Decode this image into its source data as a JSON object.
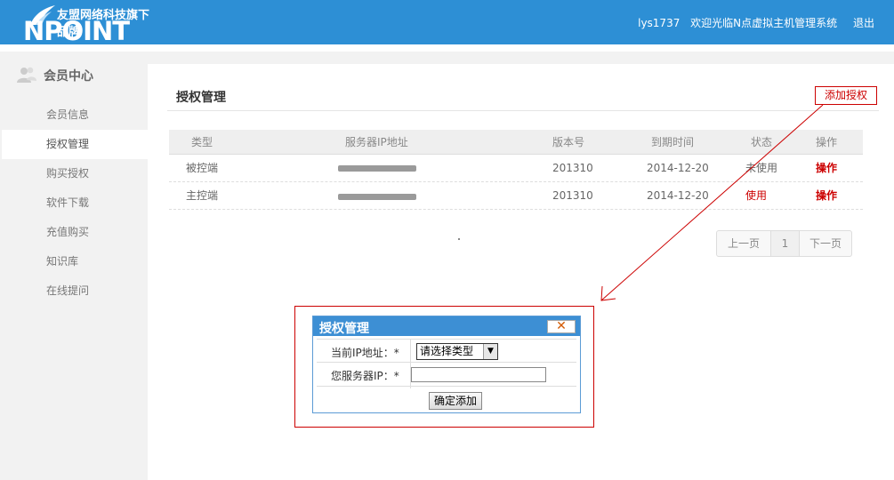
{
  "header": {
    "slogan": "友盟网络科技旗下品牌",
    "brand": "NPOINT",
    "username": "lys1737",
    "welcome": "欢迎光临N点虚拟主机管理系统",
    "logout": "退出"
  },
  "sidebar": {
    "title": "会员中心",
    "items": [
      {
        "label": "会员信息"
      },
      {
        "label": "授权管理"
      },
      {
        "label": "购买授权"
      },
      {
        "label": "软件下载"
      },
      {
        "label": "充值购买"
      },
      {
        "label": "知识库"
      },
      {
        "label": "在线提问"
      }
    ]
  },
  "main": {
    "title": "授权管理",
    "add_button": "添加授权",
    "table": {
      "headers": [
        "类型",
        "服务器IP地址",
        "版本号",
        "到期时间",
        "状态",
        "操作"
      ],
      "rows": [
        {
          "type": "被控端",
          "version": "201310",
          "expiry": "2014-12-20",
          "status": "未使用",
          "action": "操作"
        },
        {
          "type": "主控端",
          "version": "201310",
          "expiry": "2014-12-20",
          "status": "使用",
          "action": "操作"
        }
      ]
    },
    "pager": {
      "prev": "上一页",
      "page": "1",
      "next": "下一页"
    }
  },
  "dialog": {
    "title": "授权管理",
    "close": "✕",
    "ip_label": "当前IP地址：*",
    "select_value": "请选择类型",
    "server_ip_label": "您服务器IP：*",
    "confirm": "确定添加"
  },
  "colors": {
    "header_blue": "#2d8fd5",
    "annotation_red": "#cc0000"
  }
}
